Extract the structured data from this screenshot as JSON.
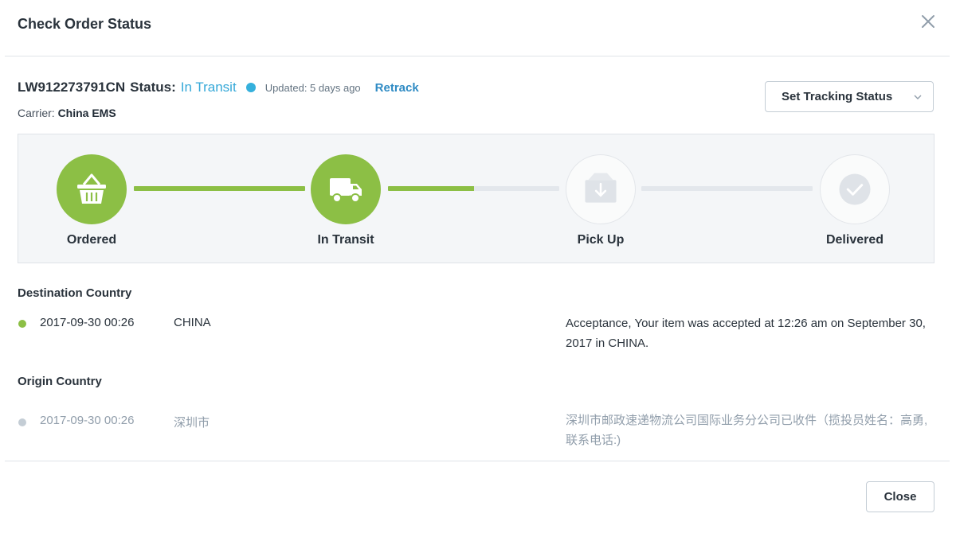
{
  "modal": {
    "title": "Check Order Status",
    "close_label": "Close"
  },
  "tracking": {
    "number": "LW912273791CN",
    "status_label": "Status:",
    "status_value": "In Transit",
    "updated": "Updated: 5 days ago",
    "retrack_label": "Retrack",
    "carrier_label": "Carrier:",
    "carrier_value": "China EMS",
    "set_status_label": "Set Tracking Status",
    "accent_color": "#35a8d8",
    "complete_color": "#8cbf45"
  },
  "progress": {
    "steps": [
      {
        "label": "Ordered",
        "icon": "basket-icon",
        "complete": true
      },
      {
        "label": "In Transit",
        "icon": "truck-icon",
        "complete": true
      },
      {
        "label": "Pick Up",
        "icon": "package-icon",
        "complete": false
      },
      {
        "label": "Delivered",
        "icon": "check-circle-icon",
        "complete": false
      }
    ],
    "connector_fill": [
      1.0,
      0.5,
      0.0
    ]
  },
  "destination": {
    "heading": "Destination Country",
    "events": [
      {
        "date": "2017-09-30 00:26",
        "location": "CHINA",
        "description": "Acceptance, Your item was accepted at 12:26 am on September 30, 2017 in CHINA."
      }
    ]
  },
  "origin": {
    "heading": "Origin Country",
    "events": [
      {
        "date": "2017-09-30 00:26",
        "location": "深圳市",
        "description": "深圳市邮政速递物流公司国际业务分公司已收件（揽投员姓名：高勇,联系电话:)"
      }
    ]
  }
}
